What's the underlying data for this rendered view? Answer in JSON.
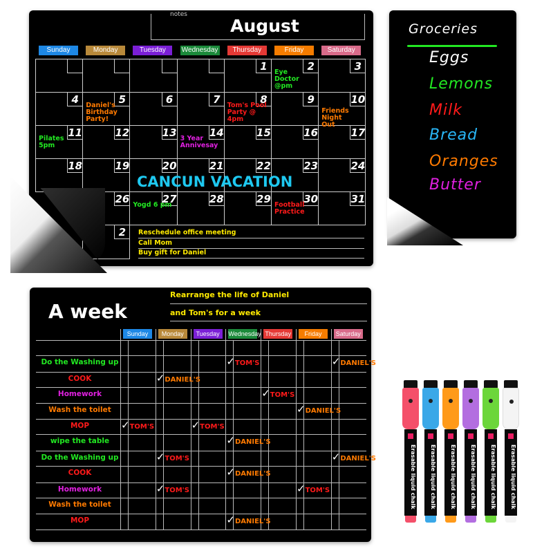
{
  "calendar": {
    "notes_label": "notes",
    "month": "August",
    "days": [
      {
        "label": "Sunday",
        "color": "#1e88e5"
      },
      {
        "label": "Monday",
        "color": "#b8893a"
      },
      {
        "label": "Tuesday",
        "color": "#7b1fd6"
      },
      {
        "label": "Wednesday",
        "color": "#1b8a3a"
      },
      {
        "label": "Thursday",
        "color": "#e53935"
      },
      {
        "label": "Friday",
        "color": "#f57c00"
      },
      {
        "label": "Saturday",
        "color": "#d96b8a"
      }
    ],
    "dates": [
      "",
      "",
      "",
      "",
      "1",
      "2",
      "3",
      "4",
      "5",
      "6",
      "7",
      "8",
      "9",
      "10",
      "11",
      "12",
      "13",
      "14",
      "15",
      "16",
      "17",
      "18",
      "19",
      "20",
      "21",
      "22",
      "23",
      "24",
      "",
      "26",
      "27",
      "28",
      "29",
      "30",
      "31"
    ],
    "extra_date": "2",
    "events": [
      {
        "cell": 5,
        "text": "Eye Doctor @pm",
        "color": "#22e822"
      },
      {
        "cell": 8,
        "text": "Daniel's Birthday Party!",
        "color": "#ff7a00"
      },
      {
        "cell": 11,
        "text": "Tom's Pool Party @ 4pm",
        "color": "#ff1a1a"
      },
      {
        "cell": 13,
        "text": "Friends Night Out",
        "color": "#ff7a00"
      },
      {
        "cell": 14,
        "text": "Pilates 5pm",
        "color": "#22e822"
      },
      {
        "cell": 17,
        "text": "3 Year Annivesay",
        "color": "#e020e0"
      },
      {
        "cell": 30,
        "text": "Yogd 6 pm",
        "color": "#22e822"
      },
      {
        "cell": 33,
        "text": "Football Practice",
        "color": "#ff1a1a"
      }
    ],
    "banner": {
      "text": "CANCUN VACATION",
      "color": "#1ec8f0"
    },
    "tasks": [
      "Reschedule office meeting",
      "Call Mom",
      "Buy gift for Daniel"
    ]
  },
  "groceries": {
    "title": "Groceries",
    "items": [
      {
        "text": "Eggs",
        "color": "#ffffff"
      },
      {
        "text": "Lemons",
        "color": "#22e822"
      },
      {
        "text": "Milk",
        "color": "#ff1a1a"
      },
      {
        "text": "Bread",
        "color": "#29b6f6"
      },
      {
        "text": "Oranges",
        "color": "#ff7a00"
      },
      {
        "text": "Butter",
        "color": "#e020e0"
      }
    ],
    "underline_color": "#22e822"
  },
  "week": {
    "title": "A week",
    "subtitle_lines": [
      "Rearrange the life of Daniel",
      "and Tom's for a week"
    ],
    "days": [
      "Sunday",
      "Monday",
      "Tuesday",
      "Wednesday",
      "Thursday",
      "Friday",
      "Saturday"
    ],
    "rows": [
      {
        "task": "Do the Washing up",
        "color": "#22e822",
        "checks": [
          {
            "day": 3,
            "name": "TOM'S"
          },
          {
            "day": 6,
            "name": "DANIEL'S"
          }
        ]
      },
      {
        "task": "COOK",
        "color": "#ff1a1a",
        "checks": [
          {
            "day": 1,
            "name": "DANIEL'S"
          }
        ]
      },
      {
        "task": "Homework",
        "color": "#e020e0",
        "checks": [
          {
            "day": 4,
            "name": "TOM'S"
          }
        ]
      },
      {
        "task": "Wash the toilet",
        "color": "#ff7a00",
        "checks": [
          {
            "day": 5,
            "name": "DANIEL'S"
          }
        ]
      },
      {
        "task": "MOP",
        "color": "#ff1a1a",
        "checks": [
          {
            "day": 0,
            "name": "TOM'S"
          },
          {
            "day": 2,
            "name": "TOM'S"
          }
        ]
      },
      {
        "task": "wipe the table",
        "color": "#22e822",
        "checks": [
          {
            "day": 3,
            "name": "DANIEL'S"
          }
        ]
      },
      {
        "task": "Do the Washing up",
        "color": "#22e822",
        "checks": [
          {
            "day": 1,
            "name": "TOM'S"
          },
          {
            "day": 6,
            "name": "DANIEL'S"
          }
        ]
      },
      {
        "task": "COOK",
        "color": "#ff1a1a",
        "checks": [
          {
            "day": 3,
            "name": "DANIEL'S"
          }
        ]
      },
      {
        "task": "Homework",
        "color": "#e020e0",
        "checks": [
          {
            "day": 1,
            "name": "TOM'S"
          },
          {
            "day": 5,
            "name": "TOM'S"
          }
        ]
      },
      {
        "task": "Wash the toilet",
        "color": "#ff7a00",
        "checks": []
      },
      {
        "task": "MOP",
        "color": "#ff1a1a",
        "checks": [
          {
            "day": 3,
            "name": "DANIEL'S"
          }
        ]
      }
    ],
    "name_colors": {
      "TOM'S": "#ff1a1a",
      "DANIEL'S": "#ff7a00"
    }
  },
  "markers": {
    "label": "Erasable liquid chalk",
    "colors": [
      "#f4506a",
      "#3aa8e8",
      "#ff9a1a",
      "#b36ee0",
      "#6cd63a",
      "#f4f4f4"
    ]
  }
}
